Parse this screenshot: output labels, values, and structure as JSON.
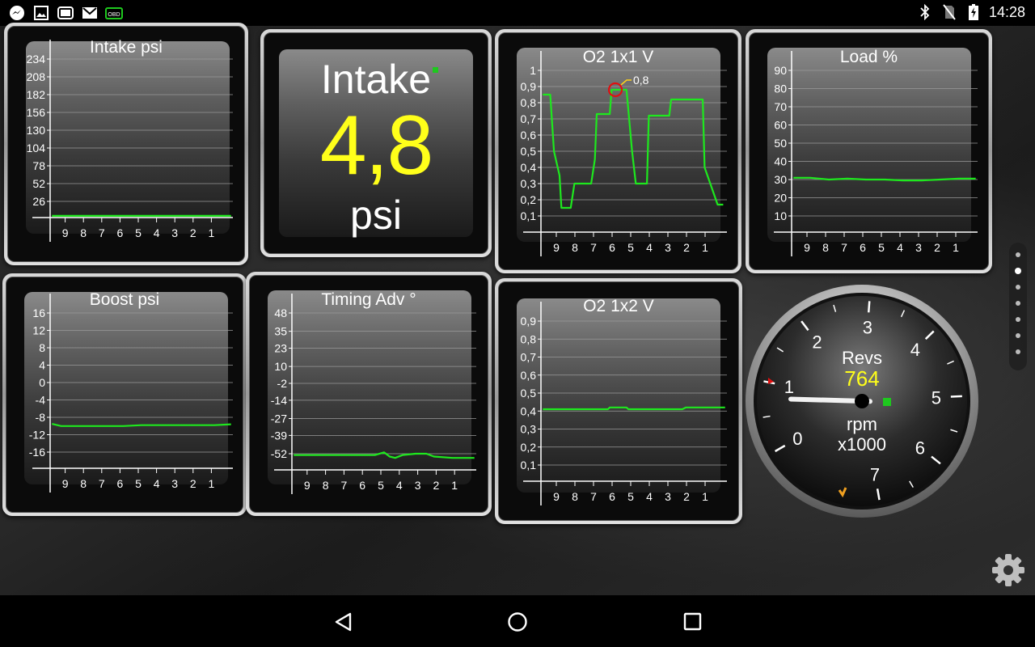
{
  "status_bar": {
    "left_icons": [
      "messenger-icon",
      "gallery-icon",
      "tv-icon",
      "gmail-icon",
      "obd-icon"
    ],
    "obd_badge": "OBD",
    "right_icons": [
      "bluetooth-icon",
      "no-sim-icon",
      "battery-charging-icon"
    ],
    "clock": "14:28"
  },
  "digital_gauge": {
    "title": "Intake",
    "value": "4,8",
    "unit": "psi"
  },
  "revs_gauge": {
    "title": "Revs",
    "value": "764",
    "unit": "rpm",
    "multiplier": "x1000",
    "ticks": [
      "0",
      "1",
      "2",
      "3",
      "4",
      "5",
      "6",
      "7"
    ],
    "needle_value": 0.764
  },
  "graphs": {
    "intake": {
      "title": "Intake psi",
      "y_ticks": [
        "234",
        "208",
        "182",
        "156",
        "130",
        "104",
        "78",
        "52",
        "26"
      ]
    },
    "o2_1x1": {
      "title": "O2 1x1 V",
      "y_ticks": [
        "1",
        "0,9",
        "0,8",
        "0,7",
        "0,6",
        "0,5",
        "0,4",
        "0,3",
        "0,2",
        "0,1"
      ],
      "marker_label": "0,8"
    },
    "load": {
      "title": "Load %",
      "y_ticks": [
        "90",
        "80",
        "70",
        "60",
        "50",
        "40",
        "30",
        "20",
        "10"
      ]
    },
    "boost": {
      "title": "Boost psi",
      "y_ticks": [
        "16",
        "12",
        "8",
        "4",
        "0",
        "-4",
        "-8",
        "-12",
        "-16"
      ]
    },
    "timing": {
      "title": "Timing Adv °",
      "y_ticks": [
        "48",
        "35",
        "23",
        "10",
        "-2",
        "-14",
        "-27",
        "-39",
        "-52"
      ]
    },
    "o2_1x2": {
      "title": "O2 1x2 V",
      "y_ticks": [
        "0,9",
        "0,8",
        "0,7",
        "0,6",
        "0,5",
        "0,4",
        "0,3",
        "0,2",
        "0,1"
      ]
    },
    "x_ticks": [
      "9",
      "8",
      "7",
      "6",
      "5",
      "4",
      "3",
      "2",
      "1"
    ]
  },
  "chart_data": [
    {
      "type": "line",
      "title": "Intake psi",
      "ylim": [
        0,
        260
      ],
      "x": [
        9.9,
        9,
        8,
        7,
        6,
        5,
        4,
        3,
        2,
        1,
        0.1
      ],
      "series": [
        {
          "values": [
            4.8,
            4.8,
            4.8,
            4.8,
            4.8,
            4.8,
            4.8,
            4.8,
            4.8,
            4.8,
            4.8
          ],
          "color": "#1ee81e"
        }
      ]
    },
    {
      "type": "line",
      "title": "O2 1x1 V",
      "ylim": [
        0,
        1
      ],
      "x": [
        9.9,
        9.5,
        9.3,
        9.0,
        8.9,
        8.4,
        8.2,
        7.3,
        7.1,
        7.0,
        6.3,
        6.2,
        5.7,
        5.4,
        5.1,
        4.9,
        4.3,
        4.2,
        3.1,
        3.0,
        2.1,
        1.9,
        1.3,
        1.2,
        0.5,
        0.2
      ],
      "series": [
        {
          "values": [
            0.85,
            0.85,
            0.5,
            0.35,
            0.15,
            0.15,
            0.3,
            0.3,
            0.45,
            0.73,
            0.73,
            0.88,
            0.88,
            0.88,
            0.5,
            0.3,
            0.3,
            0.72,
            0.72,
            0.82,
            0.82,
            0.82,
            0.82,
            0.4,
            0.17,
            0.17
          ],
          "color": "#1ee81e"
        }
      ],
      "annotation": {
        "label": "0,8"
      }
    },
    {
      "type": "line",
      "title": "Load %",
      "ylim": [
        0,
        95
      ],
      "x": [
        9.9,
        9,
        8,
        7,
        6,
        5,
        4,
        3,
        2,
        1,
        0.1
      ],
      "series": [
        {
          "values": [
            31,
            31,
            30,
            30.5,
            30,
            30,
            29.5,
            29.5,
            30,
            30.5,
            30.5
          ],
          "color": "#1ee81e"
        }
      ]
    },
    {
      "type": "line",
      "title": "Boost psi",
      "ylim": [
        -20,
        18
      ],
      "x": [
        9.9,
        9.4,
        9,
        8,
        7,
        6,
        5,
        4,
        3,
        2,
        1,
        0.1
      ],
      "series": [
        {
          "values": [
            -9.5,
            -10,
            -10,
            -10,
            -10,
            -10,
            -9.8,
            -9.8,
            -9.8,
            -9.8,
            -9.8,
            -9.6
          ],
          "color": "#1ee81e"
        }
      ]
    },
    {
      "type": "line",
      "title": "Timing Adv °",
      "ylim": [
        -60,
        52
      ],
      "x": [
        9.9,
        9,
        8,
        7,
        6,
        5.5,
        5.0,
        4.7,
        4.4,
        4.0,
        3.3,
        2.7,
        2.3,
        1.3,
        0.1
      ],
      "series": [
        {
          "values": [
            -53,
            -53,
            -53,
            -53,
            -53,
            -53,
            -51,
            -54,
            -55,
            -53,
            -52,
            -52,
            -54,
            -55,
            -55
          ],
          "color": "#1ee81e"
        }
      ]
    },
    {
      "type": "line",
      "title": "O2 1x2 V",
      "ylim": [
        0,
        0.95
      ],
      "x": [
        9.9,
        9,
        8,
        7,
        6.4,
        6.3,
        5.4,
        5.3,
        4,
        3,
        2.4,
        2.2,
        1,
        0.1
      ],
      "series": [
        {
          "values": [
            0.41,
            0.41,
            0.41,
            0.41,
            0.41,
            0.42,
            0.42,
            0.41,
            0.41,
            0.41,
            0.41,
            0.42,
            0.42,
            0.42
          ],
          "color": "#1ee81e"
        }
      ]
    }
  ],
  "nav": {
    "icons": [
      "back-icon",
      "home-icon",
      "recents-icon"
    ]
  },
  "page_indicator": {
    "count": 7,
    "active": 1
  },
  "settings": {
    "icon": "gear-icon"
  }
}
